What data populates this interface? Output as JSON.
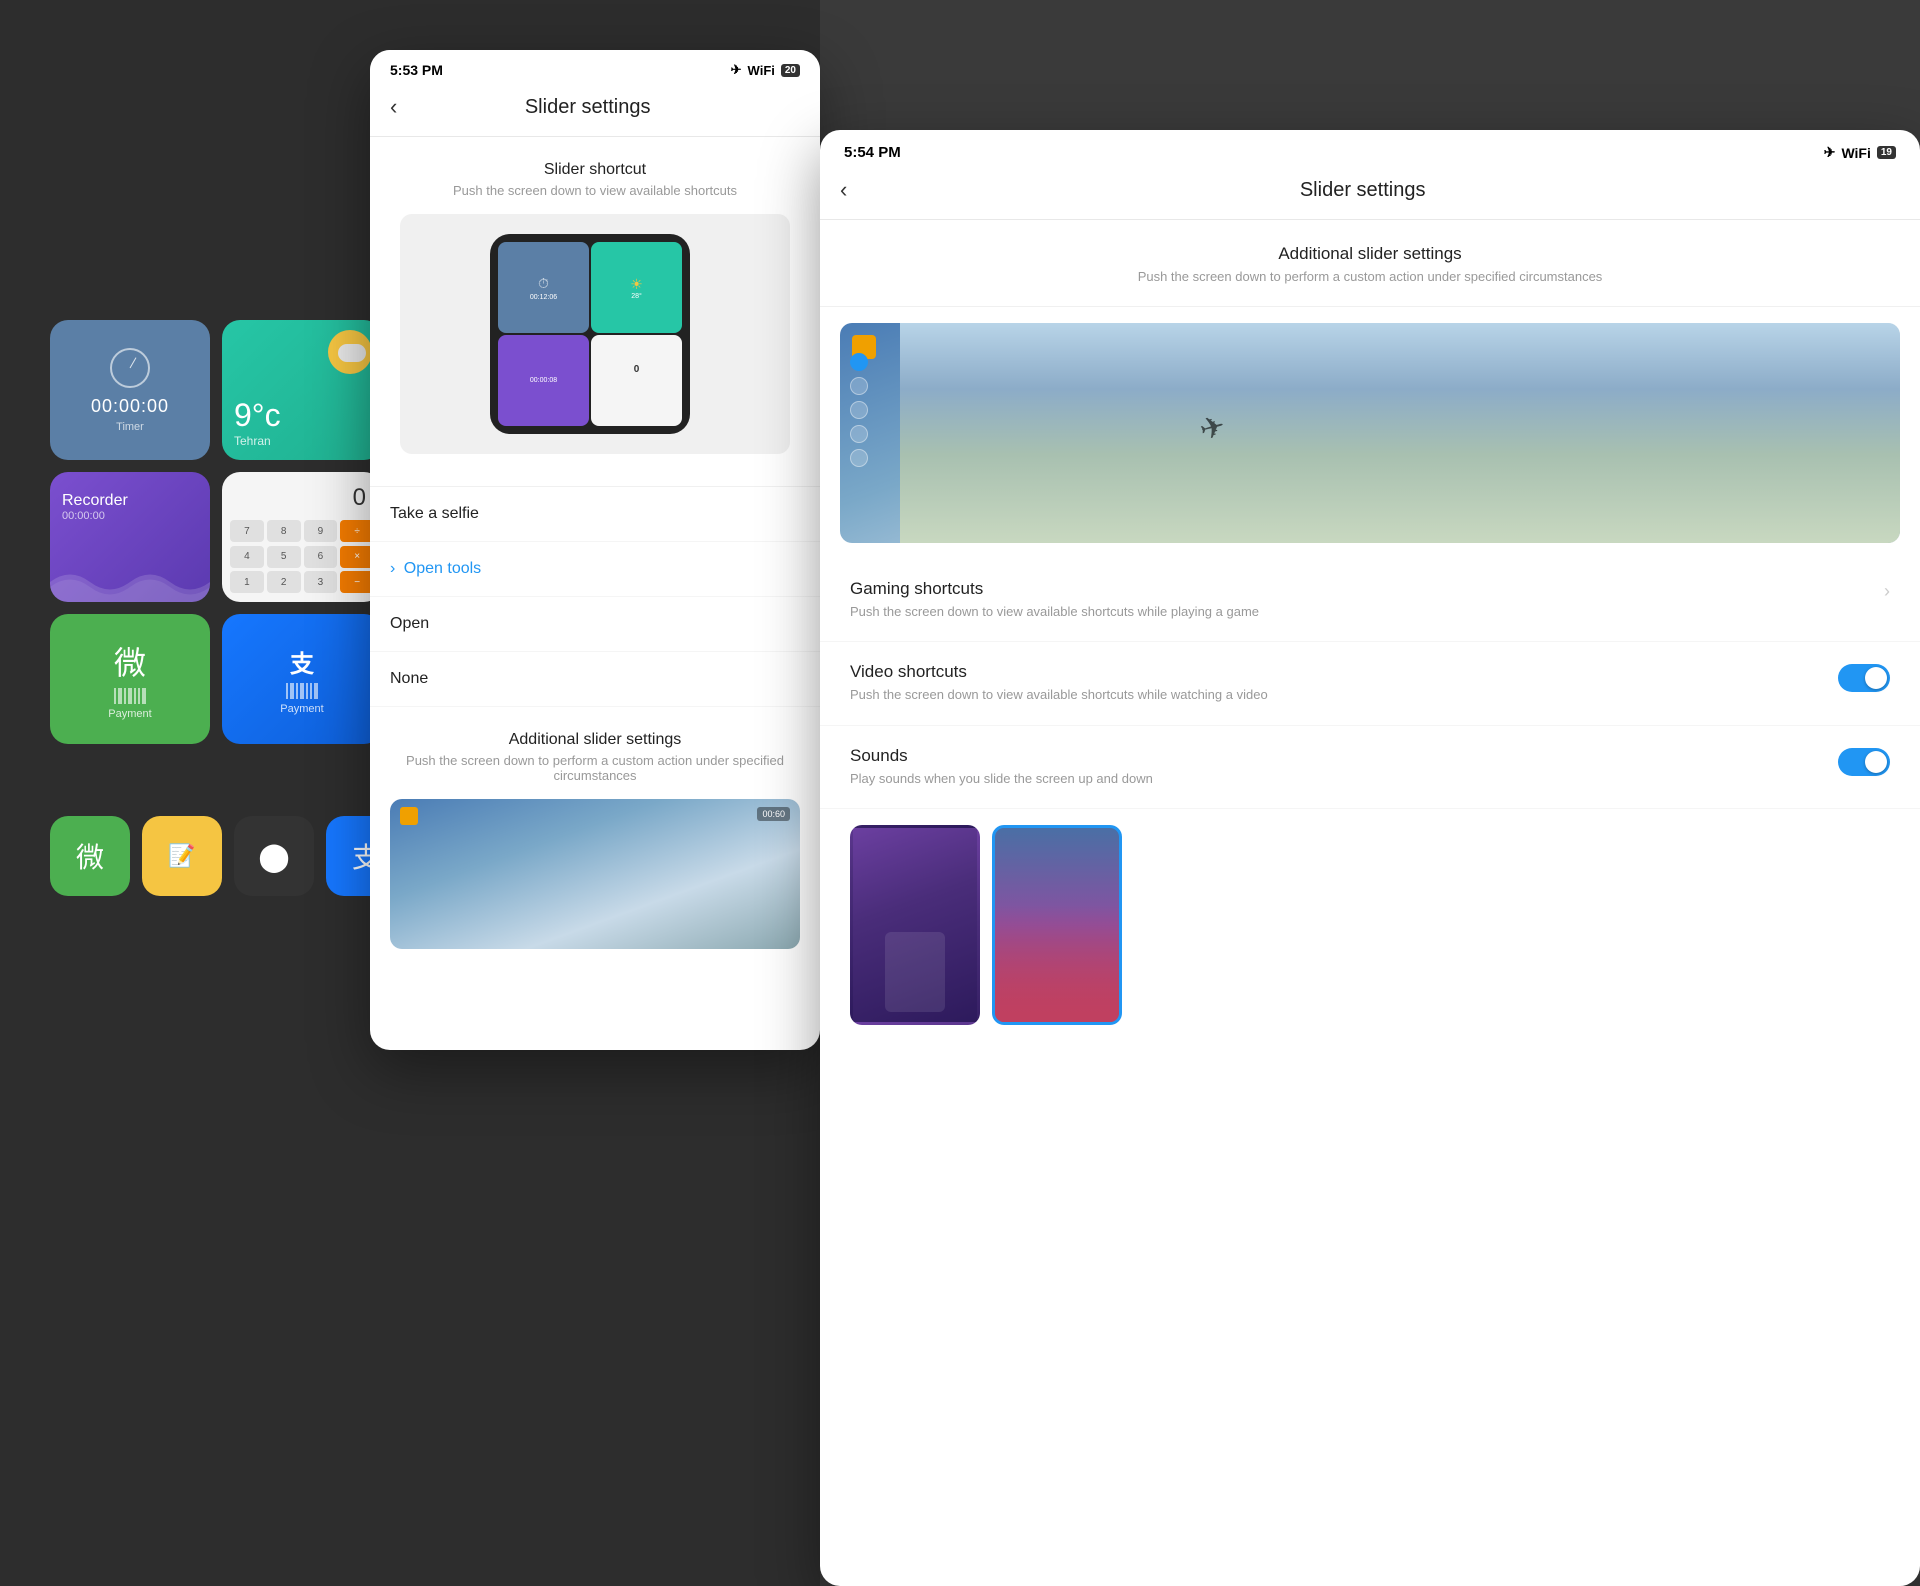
{
  "background": {
    "color": "#2d2d2d"
  },
  "left_panel": {
    "tiles": [
      {
        "type": "timer",
        "time": "00:00:00",
        "label": "Timer"
      },
      {
        "type": "weather",
        "temp": "9°c",
        "city": "Tehran"
      },
      {
        "type": "recorder",
        "label": "Recorder",
        "time": "00:00:00"
      },
      {
        "type": "calculator",
        "display": "0"
      }
    ],
    "payment_tiles": [
      {
        "app": "WeChat",
        "label": "Payment"
      },
      {
        "app": "Alipay",
        "label": "Payment"
      }
    ],
    "small_icons": [
      "WeChat",
      "Notes",
      "Camera",
      "Alipay"
    ]
  },
  "center_phone": {
    "status_time": "5:53 PM",
    "battery": "20",
    "title": "Slider  settings",
    "back_label": "‹",
    "slider_shortcut": {
      "section_title": "Slider shortcut",
      "section_subtitle": "Push the screen down to view available shortcuts"
    },
    "menu_items": [
      {
        "label": "Take a selfie",
        "active": false
      },
      {
        "label": "Open tools",
        "active": true,
        "chevron": true
      },
      {
        "label": "Open",
        "active": false
      },
      {
        "label": "None",
        "active": false
      }
    ],
    "additional_section": {
      "title": "Additional slider settings",
      "subtitle": "Push the screen down to perform a custom action under specified circumstances"
    }
  },
  "right_phone": {
    "status_time": "5:54 PM",
    "battery": "19",
    "title": "Slider  settings",
    "back_label": "‹",
    "additional_slider": {
      "title": "Additional slider settings",
      "subtitle": "Push the screen down to perform a custom action under specified circumstances"
    },
    "gaming_shortcuts": {
      "title": "Gaming shortcuts",
      "desc": "Push the screen down to view available shortcuts while playing a game"
    },
    "video_shortcuts": {
      "title": "Video shortcuts",
      "desc": "Push the screen down to view available shortcuts while watching a video",
      "toggle": true
    },
    "sounds": {
      "title": "Sounds",
      "desc": "Play sounds when you slide the screen up and down",
      "toggle": true
    },
    "wallpapers": [
      {
        "type": "purple",
        "selected": false
      },
      {
        "type": "building",
        "selected": true
      }
    ]
  }
}
